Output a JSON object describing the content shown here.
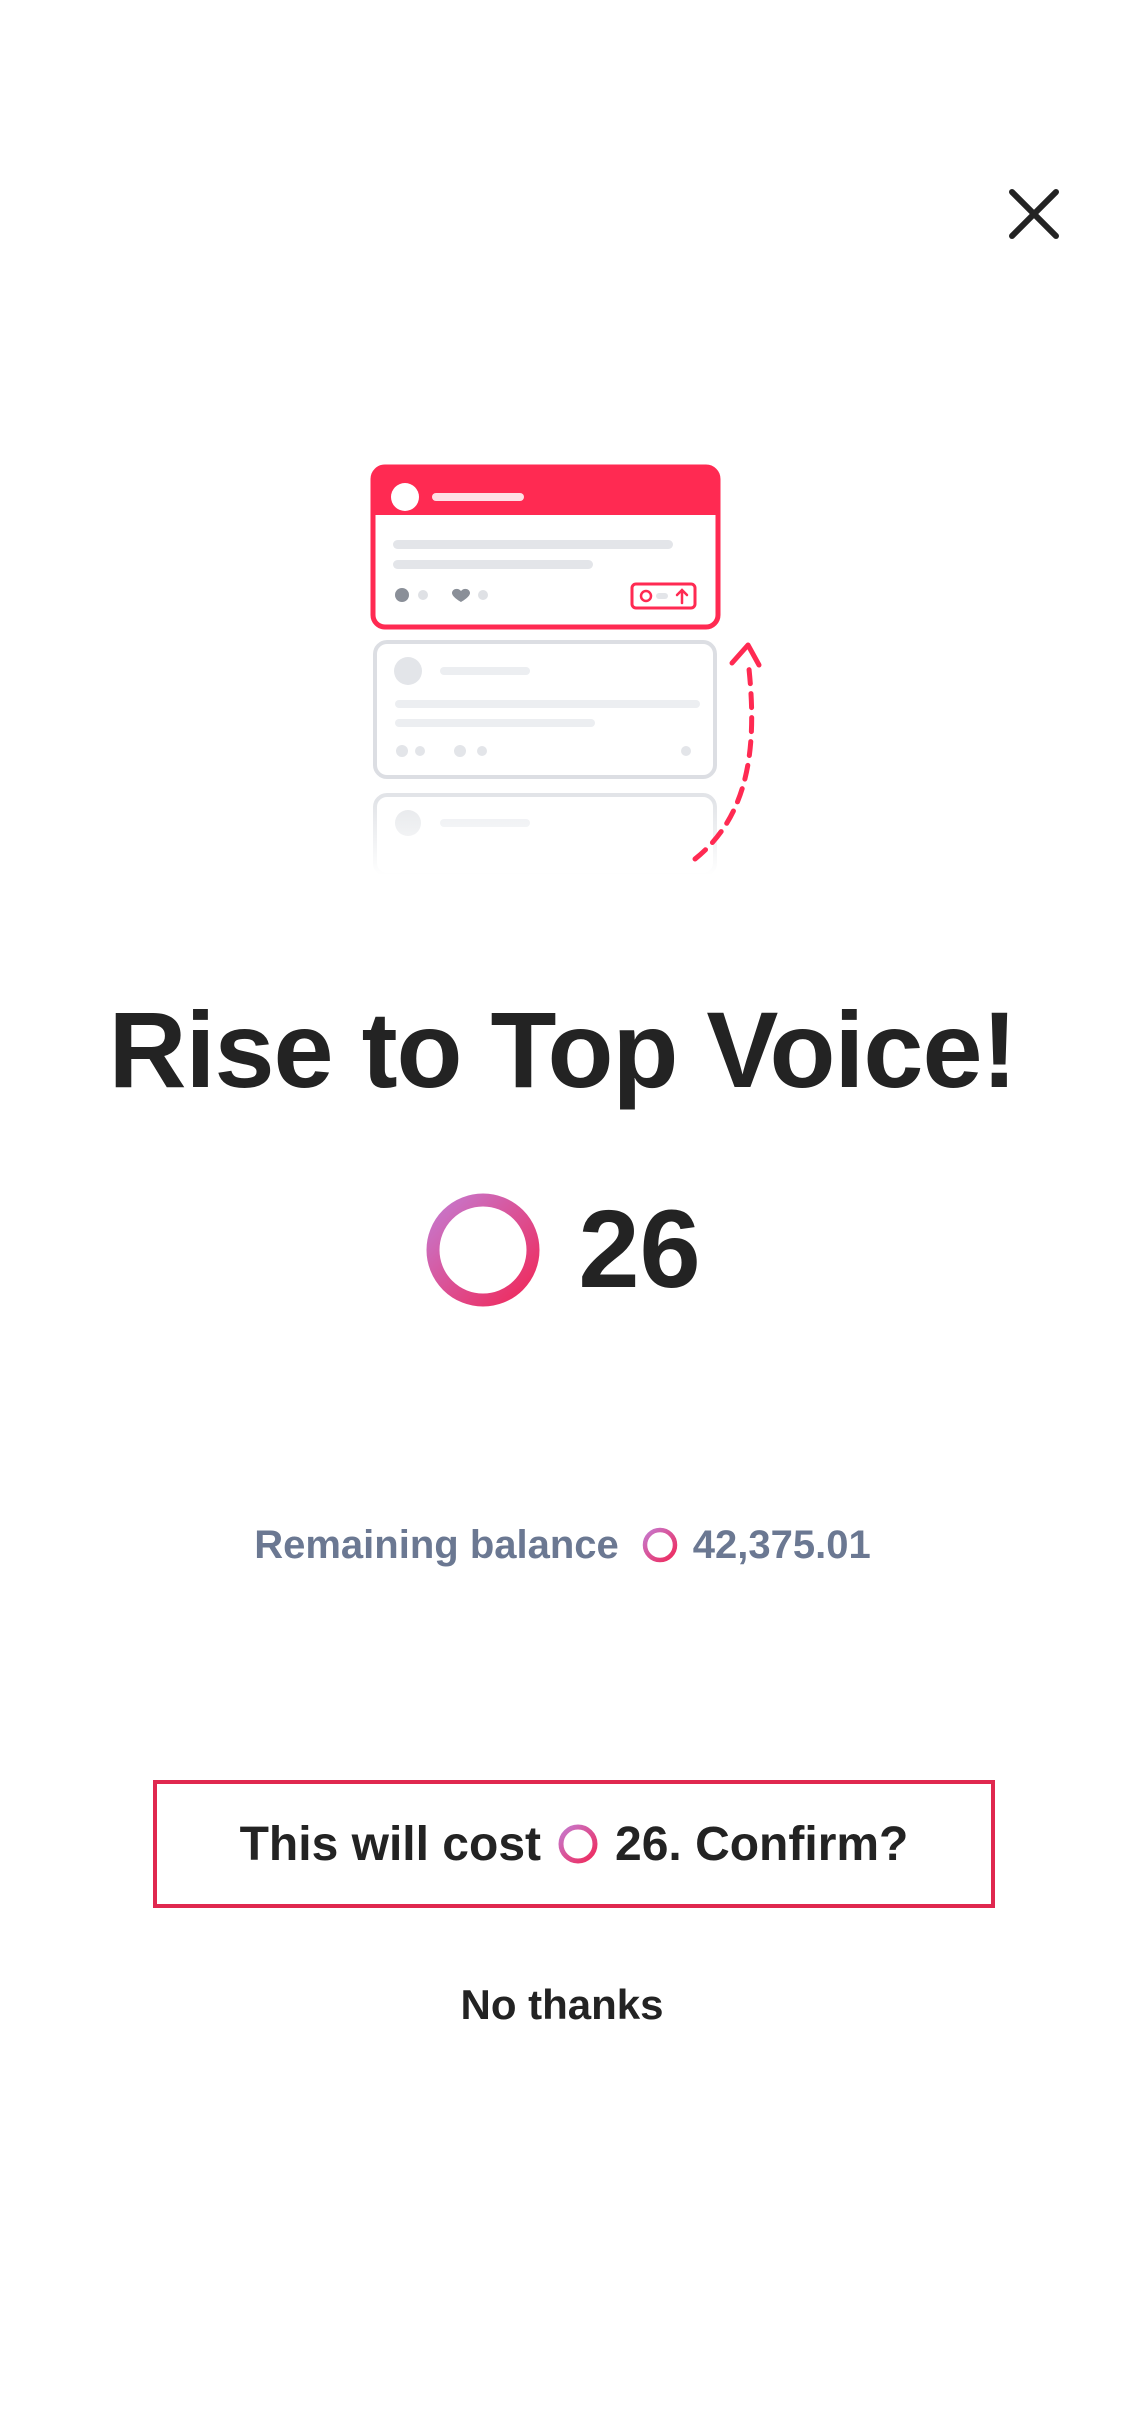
{
  "close": {
    "icon": "close-icon"
  },
  "illustration": {
    "icon": "post-rising-to-top-illustration",
    "accent": "#ff2a52"
  },
  "title": "Rise to Top Voice!",
  "price": {
    "amount": "26",
    "icon": "coin-ring-icon"
  },
  "balance": {
    "label": "Remaining balance",
    "amount": "42,375.01",
    "icon": "coin-ring-icon"
  },
  "confirm": {
    "prefix": "This will cost",
    "suffix": "26. Confirm?",
    "border_color": "#e0284f"
  },
  "decline": {
    "label": "No thanks"
  },
  "colors": {
    "text": "#232323",
    "muted": "#6b7892",
    "coin_start": "#c57ad0",
    "coin_end": "#f0285a"
  }
}
